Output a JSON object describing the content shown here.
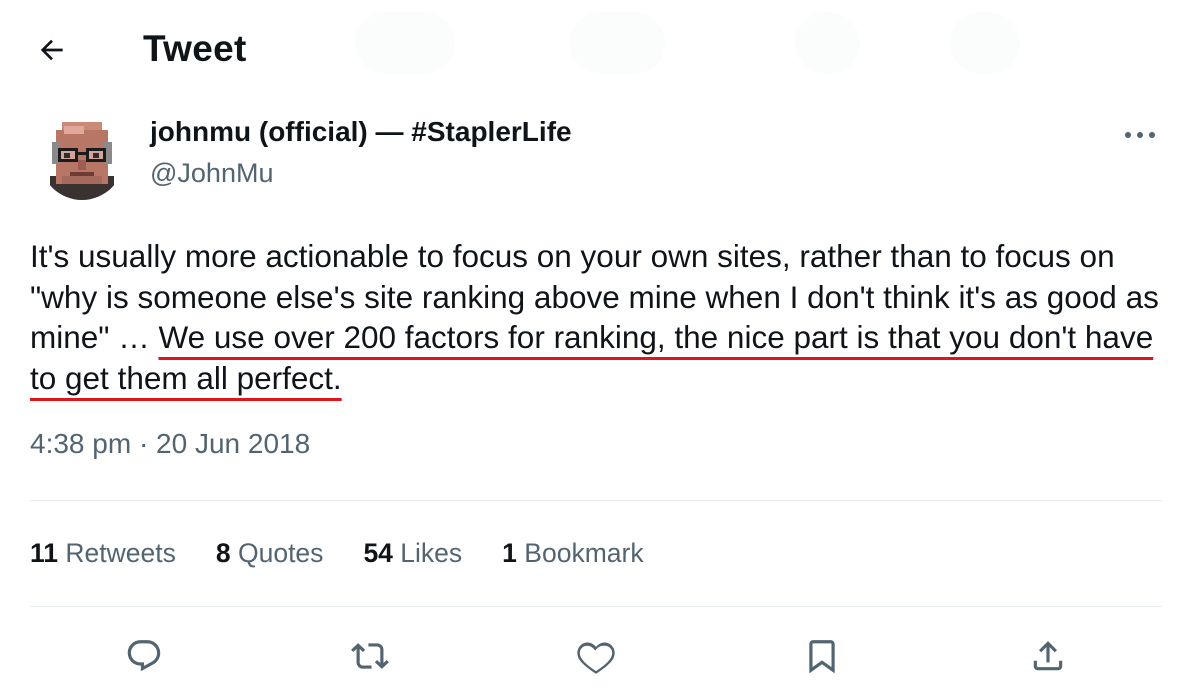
{
  "header": {
    "title": "Tweet"
  },
  "author": {
    "name": "johnmu (official) — #StaplerLife",
    "handle": "@JohnMu"
  },
  "tweet": {
    "text_before": "It's usually more actionable to focus on your own sites, rather than to focus on \"why is someone else's site ranking above mine when I don't think it's as good as mine\" … ",
    "text_highlighted": "We use over 200 factors for ranking, the nice part is that you don't have to get them all perfect.",
    "timestamp": "4:38 pm · 20 Jun 2018",
    "highlight_color": "#e0141e"
  },
  "stats": [
    {
      "count": "11",
      "label": "Retweets"
    },
    {
      "count": "8",
      "label": "Quotes"
    },
    {
      "count": "54",
      "label": "Likes"
    },
    {
      "count": "1",
      "label": "Bookmark"
    }
  ],
  "actions": [
    {
      "icon": "reply-icon"
    },
    {
      "icon": "retweet-icon"
    },
    {
      "icon": "like-icon"
    },
    {
      "icon": "bookmark-icon"
    },
    {
      "icon": "share-icon"
    }
  ]
}
